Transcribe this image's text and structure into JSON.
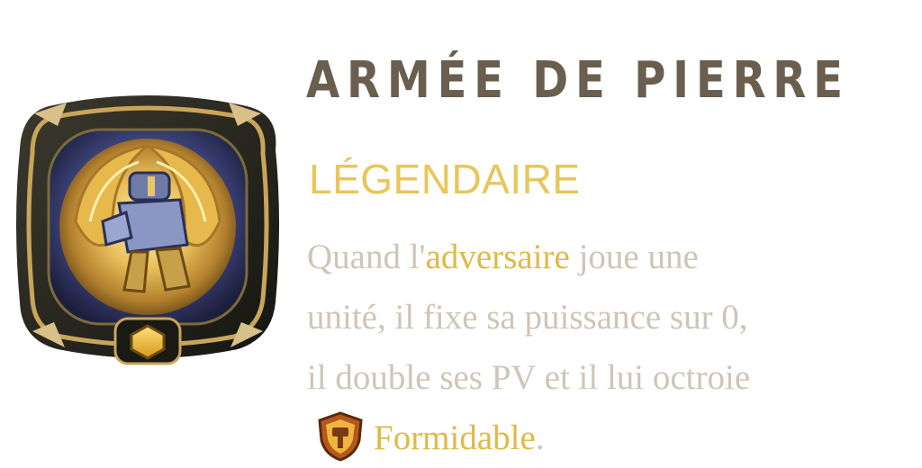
{
  "card": {
    "icon": "stone-army-card-art",
    "name": "ARMÉE DE PIERRE",
    "rarity": "LÉGENDAIRE",
    "description": {
      "line1_prefix": "Quand l'",
      "line1_keyword": "adversaire",
      "line1_suffix": " joue une",
      "line2": "unité, il fixe sa puissance sur 0,",
      "line3": "il double ses PV et il lui octroie",
      "keyword_icon": "formidable-shield-icon",
      "keyword": "Formidable",
      "ending": "."
    }
  },
  "colors": {
    "title": "#6a5e4e",
    "rarity": "#e9c65a",
    "text": "#cfc5b7",
    "keyword": "#e0b948"
  }
}
